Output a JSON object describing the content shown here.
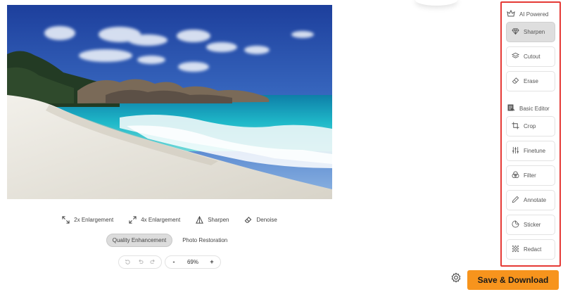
{
  "enhancement_options": [
    {
      "label": "2x Enlargement",
      "icon": "expand-arrows-icon"
    },
    {
      "label": "4x Enlargement",
      "icon": "expand-arrows-icon"
    },
    {
      "label": "Sharpen",
      "icon": "sharpen-triangle-icon"
    },
    {
      "label": "Denoise",
      "icon": "eraser-icon"
    }
  ],
  "modes": {
    "quality": "Quality Enhancement",
    "restoration": "Photo Restoration",
    "active": "Quality Enhancement"
  },
  "zoom": {
    "value": "69%",
    "minus": "-",
    "plus": "+"
  },
  "side_panel": {
    "ai_section": "AI Powered",
    "ai_tools": [
      {
        "label": "Sharpen",
        "icon": "diamond-icon",
        "active": true
      },
      {
        "label": "Cutout",
        "icon": "layers-icon",
        "active": false
      },
      {
        "label": "Erase",
        "icon": "eraser-icon",
        "active": false
      }
    ],
    "basic_section": "Basic Editor",
    "basic_tools": [
      {
        "label": "Crop",
        "icon": "crop-icon"
      },
      {
        "label": "Finetune",
        "icon": "sliders-icon"
      },
      {
        "label": "Filter",
        "icon": "filter-circles-icon"
      },
      {
        "label": "Annotate",
        "icon": "pencil-icon"
      },
      {
        "label": "Sticker",
        "icon": "sticker-icon"
      },
      {
        "label": "Redact",
        "icon": "redact-grid-icon"
      }
    ]
  },
  "save_button": "Save & Download",
  "colors": {
    "accent": "#f7941d",
    "highlight_border": "#e53935",
    "active_tool": "#dedede"
  }
}
